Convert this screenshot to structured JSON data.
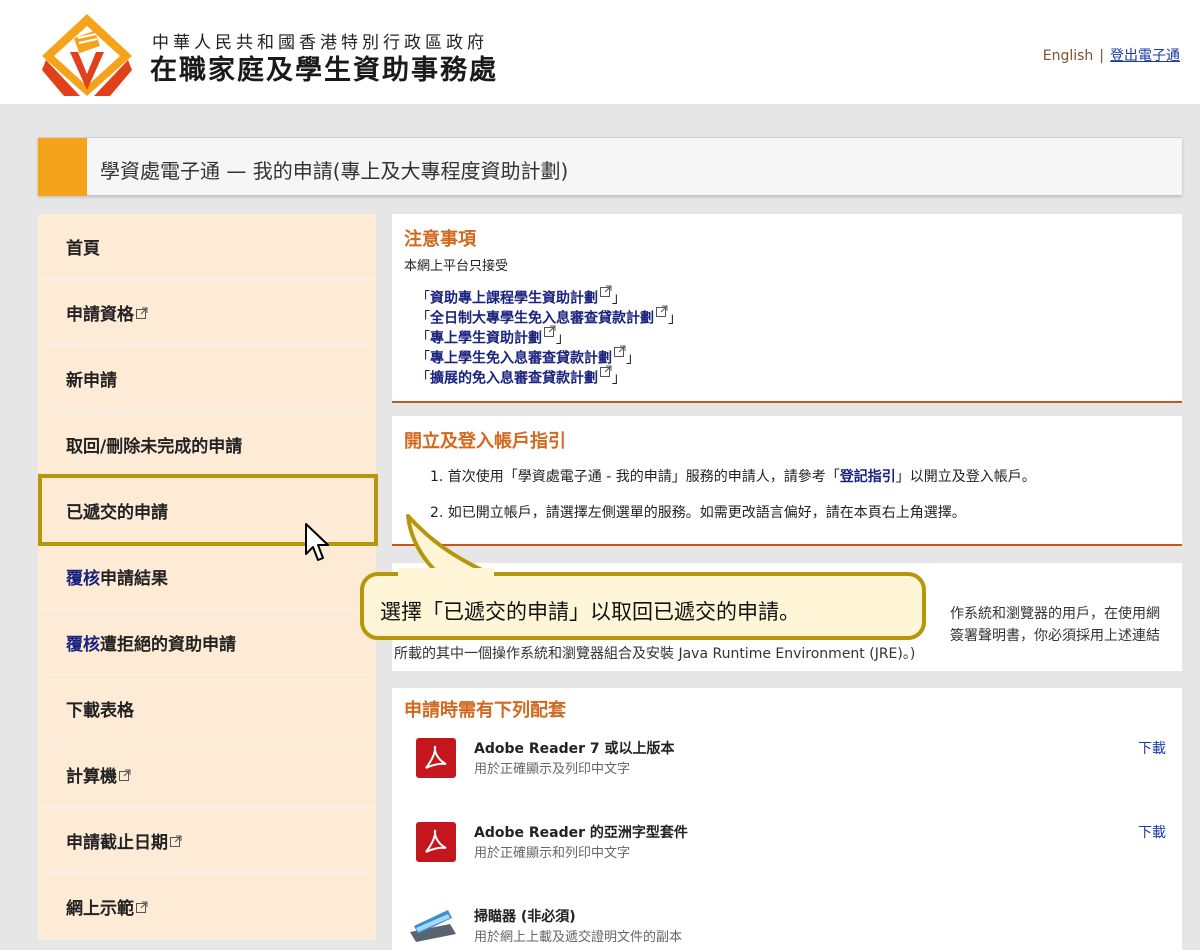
{
  "header": {
    "org_sub": "中華人民共和國香港特別行政區政府",
    "org_main": "在職家庭及學生資助事務處",
    "lang_link": "English",
    "separator": "|",
    "logout_link": "登出電子通",
    "logo_icon": "wfsfaa-logo-icon"
  },
  "page_title": "學資處電子通 — 我的申請(專上及大專程度資助計劃)",
  "colors": {
    "accent_orange": "#f5a31a",
    "sidebar_bg": "#fdebd6",
    "heading_orange": "#d2691e",
    "link_navy": "#1a237e",
    "highlight_gold": "#b8960c",
    "callout_bg": "#fff6d8"
  },
  "sidebar": {
    "items": [
      {
        "label": "首頁"
      },
      {
        "label": "申請資格"
      },
      {
        "label": "新申請"
      },
      {
        "label": "取回/刪除未完成的申請"
      },
      {
        "label": "已遞交的申請"
      },
      {
        "label_prefix": "覆核",
        "label": "申請結果"
      },
      {
        "label_prefix": "覆核",
        "label": "遭拒絕的資助申請"
      },
      {
        "label": "下載表格"
      },
      {
        "label": "計算機"
      },
      {
        "label": "申請截止日期"
      },
      {
        "label": "網上示範"
      }
    ],
    "selected_index": 4
  },
  "notice": {
    "heading": "注意事項",
    "intro": "本網上平台只接受",
    "open_q": "「",
    "close_q": "」",
    "schemes": [
      "資助專上課程學生資助計劃",
      "全日制大專學生免入息審查貸款計劃",
      "專上學生資助計劃",
      "專上學生免入息審查貸款計劃",
      "擴展的免入息審查貸款計劃"
    ]
  },
  "guide": {
    "heading": "開立及登入帳戶指引",
    "step1_pre": "1. 首次使用「學資處電子通 - 我的申請」服務的申請人，請參考「",
    "step1_link": "登記指引",
    "step1_post": "」以開立及登入帳戶。",
    "step2": "2. 如已開立帳戶，請選擇左側選單的服務。如需更改語言偏好，請在本頁右上角選擇。"
  },
  "partial_panel": {
    "line1": "作系統和瀏覽器的用戶，在使用網",
    "line2": "簽署聲明書，你必須採用上述連結",
    "line3": "所載的其中一個操作系統和瀏覽器組合及安裝 Java Runtime Environment (JRE)。)"
  },
  "software": {
    "heading": "申請時需有下列配套",
    "items": [
      {
        "name": "Adobe Reader 7 或以上版本",
        "desc": "用於正確顯示及列印中文字",
        "download": "下載",
        "icon": "adobe-pdf-icon"
      },
      {
        "name": "Adobe Reader 的亞洲字型套件",
        "desc": "用於正確顯示和列印中文字",
        "download": "下載",
        "icon": "adobe-pdf-icon"
      },
      {
        "name": "掃瞄器 (非必須)",
        "desc": "用於網上上載及遞交證明文件的副本",
        "download": "",
        "icon": "scanner-icon"
      }
    ]
  },
  "callout": {
    "text": "選擇「已遞交的申請」以取回已遞交的申請。"
  }
}
